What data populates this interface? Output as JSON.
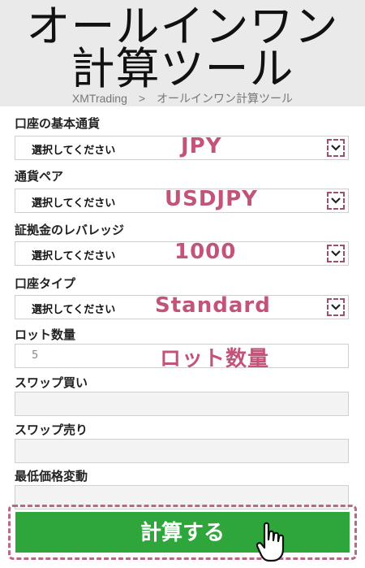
{
  "header": {
    "title_line1": "オールインワン",
    "title_line2": "計算ツール",
    "breadcrumb": {
      "home": "XMTrading",
      "separator": ">",
      "current": "オールインワン計算ツール"
    }
  },
  "form": {
    "account_currency": {
      "label": "口座の基本通貨",
      "placeholder": "選択してください",
      "annotation": "JPY"
    },
    "currency_pair": {
      "label": "通貨ペア",
      "placeholder": "選択してください",
      "annotation": "USDJPY"
    },
    "leverage": {
      "label": "証拠金のレバレッジ",
      "placeholder": "選択してください",
      "annotation": "1000"
    },
    "account_type": {
      "label": "口座タイプ",
      "placeholder": "選択してください",
      "annotation": "Standard"
    },
    "lot_size": {
      "label": "ロット数量",
      "value": "5",
      "annotation": "ロット数量"
    },
    "swap_buy": {
      "label": "スワップ買い",
      "value": ""
    },
    "swap_sell": {
      "label": "スワップ売り",
      "value": ""
    },
    "min_price_change": {
      "label": "最低価格変動",
      "value": ""
    }
  },
  "submit": {
    "label": "計算する"
  },
  "colors": {
    "header_bg": "#eaeaea",
    "accent": "#2fa63c",
    "annotation": "#c25478",
    "dashed_border": "#b86785"
  },
  "icons": [
    "chevron-down-icon",
    "pointer-hand-icon"
  ]
}
